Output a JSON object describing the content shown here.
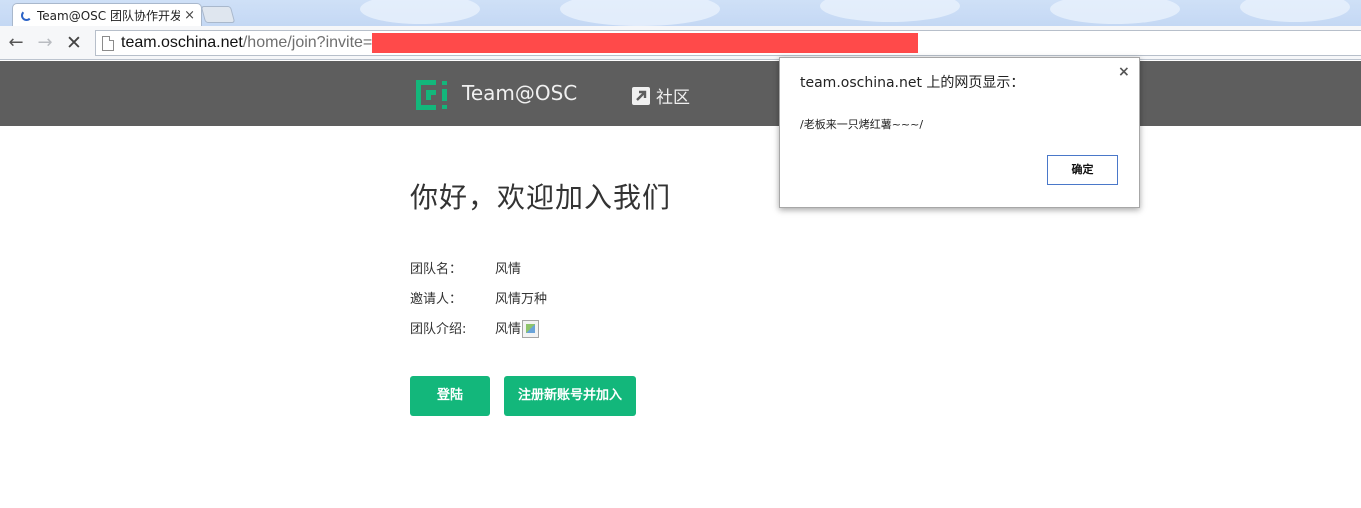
{
  "browser": {
    "tab_title": "Team@OSC 团队协作开发",
    "tab_close_glyph": "×",
    "url_host": "team.oschina.net",
    "url_path": "/home/join?invite=",
    "url_redacted_color": "#ff4a4a"
  },
  "header": {
    "brand": "Team@OSC",
    "community": "社区",
    "background_color": "#5e5e5e",
    "logo_color": "#13b77b"
  },
  "main": {
    "welcome": "你好，欢迎加入我们",
    "info": [
      {
        "label": "团队名：",
        "value": "风情"
      },
      {
        "label": "邀请人：",
        "value": "风情万种"
      },
      {
        "label": "团队介绍:",
        "value": "风情"
      }
    ],
    "buttons": {
      "login": "登陆",
      "register": "注册新账号并加入"
    },
    "accent_color": "#13b77b"
  },
  "dialog": {
    "title": "team.oschina.net 上的网页显示：",
    "message": "/老板来一只烤红薯~~~/",
    "ok": "确定",
    "close_glyph": "×"
  }
}
